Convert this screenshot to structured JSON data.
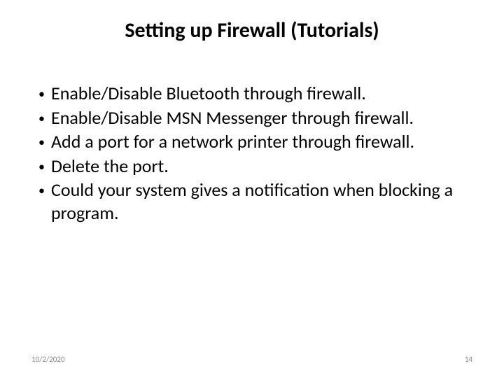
{
  "title": "Setting up Firewall (Tutorials)",
  "bullets": [
    "Enable/Disable Bluetooth through firewall.",
    "Enable/Disable MSN Messenger through firewall.",
    "Add a port for a network printer through firewall.",
    "Delete the port.",
    "Could your system gives a notification when blocking  a program."
  ],
  "footer": {
    "date": "10/2/2020",
    "page": "14"
  }
}
